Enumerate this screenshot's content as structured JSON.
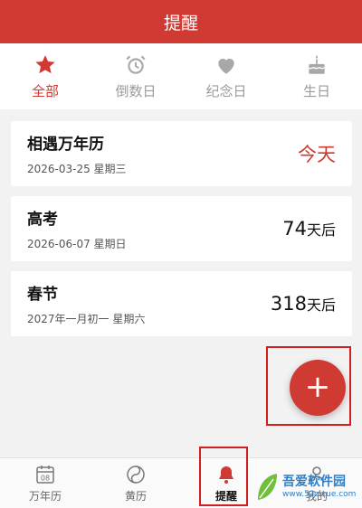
{
  "header": {
    "title": "提醒"
  },
  "tabs": [
    {
      "label": "全部",
      "icon": "star-icon",
      "active": true
    },
    {
      "label": "倒数日",
      "icon": "alarm-clock-icon",
      "active": false
    },
    {
      "label": "纪念日",
      "icon": "heart-icon",
      "active": false
    },
    {
      "label": "生日",
      "icon": "cake-icon",
      "active": false
    }
  ],
  "reminders": [
    {
      "name": "相遇万年历",
      "date": "2026-03-25 星期三",
      "countdown_text": "今天"
    },
    {
      "name": "高考",
      "date": "2026-06-07 星期日",
      "days": "74",
      "unit": "天后"
    },
    {
      "name": "春节",
      "date": "2027年一月初一 星期六",
      "days": "318",
      "unit": "天后"
    }
  ],
  "fab": {
    "symbol": "+"
  },
  "bottom_nav": [
    {
      "label": "万年历",
      "icon": "calendar-icon",
      "badge": "08"
    },
    {
      "label": "黄历",
      "icon": "yin-yang-icon"
    },
    {
      "label": "提醒",
      "icon": "bell-icon",
      "active": true
    },
    {
      "label": "我的",
      "icon": "person-icon"
    }
  ],
  "watermark": {
    "main": "吾爱软件园",
    "sub": "www.52zixue.com"
  },
  "colors": {
    "accent": "#cf3a33",
    "highlight_box": "#d11f1f",
    "inactive": "#9a9a9a"
  }
}
